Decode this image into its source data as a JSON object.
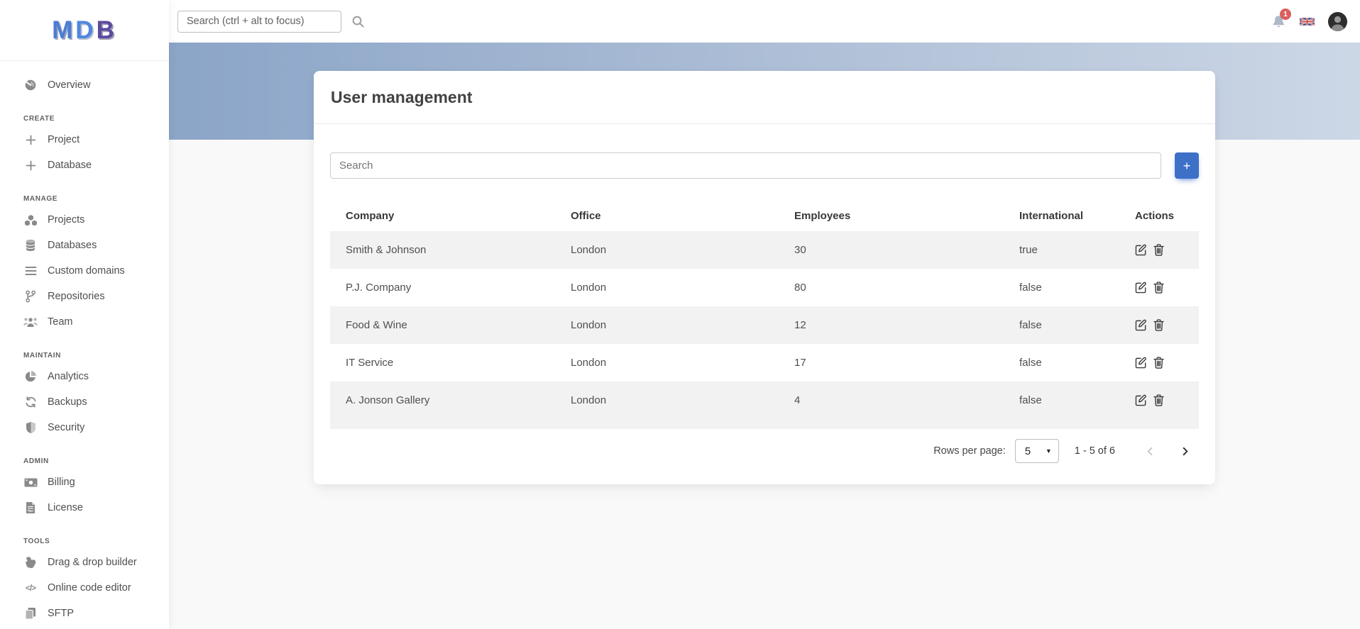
{
  "colors": {
    "accent": "#3e70c8",
    "hero_from": "#8ba5c8",
    "hero_to": "#ccd7e6",
    "stripe": "#f2f2f2",
    "badge_red": "#d9605e"
  },
  "brand": {
    "letters": [
      {
        "char": "M"
      },
      {
        "char": "D"
      },
      {
        "char": "B"
      }
    ]
  },
  "topbar": {
    "search_placeholder": "Search (ctrl + alt to focus)",
    "notification_count": "1"
  },
  "sidebar": {
    "sections": [
      {
        "label": "",
        "items": [
          {
            "label": "Overview",
            "icon": "tachometer"
          }
        ]
      },
      {
        "label": "CREATE",
        "items": [
          {
            "label": "Project",
            "icon": "plus"
          },
          {
            "label": "Database",
            "icon": "plus"
          }
        ]
      },
      {
        "label": "MANAGE",
        "items": [
          {
            "label": "Projects",
            "icon": "cubes"
          },
          {
            "label": "Databases",
            "icon": "database"
          },
          {
            "label": "Custom domains",
            "icon": "list"
          },
          {
            "label": "Repositories",
            "icon": "code-branch"
          },
          {
            "label": "Team",
            "icon": "users"
          }
        ]
      },
      {
        "label": "MAINTAIN",
        "items": [
          {
            "label": "Analytics",
            "icon": "chart-pie"
          },
          {
            "label": "Backups",
            "icon": "sync"
          },
          {
            "label": "Security",
            "icon": "shield"
          }
        ]
      },
      {
        "label": "ADMIN",
        "items": [
          {
            "label": "Billing",
            "icon": "money-bill"
          },
          {
            "label": "License",
            "icon": "file-contract"
          }
        ]
      },
      {
        "label": "TOOLS",
        "items": [
          {
            "label": "Drag & drop builder",
            "icon": "hand-pointer"
          },
          {
            "label": "Online code editor",
            "icon": "code"
          },
          {
            "label": "SFTP",
            "icon": "copy"
          }
        ]
      }
    ]
  },
  "card": {
    "title": "User management",
    "search_placeholder": "Search",
    "add_button_label": "+"
  },
  "table": {
    "columns": [
      "Company",
      "Office",
      "Employees",
      "International",
      "Actions"
    ],
    "rows": [
      {
        "company": "Smith & Johnson",
        "office": "London",
        "employees": "30",
        "international": "true"
      },
      {
        "company": "P.J. Company",
        "office": "London",
        "employees": "80",
        "international": "false"
      },
      {
        "company": "Food & Wine",
        "office": "London",
        "employees": "12",
        "international": "false"
      },
      {
        "company": "IT Service",
        "office": "London",
        "employees": "17",
        "international": "false"
      },
      {
        "company": "A. Jonson Gallery",
        "office": "London",
        "employees": "4",
        "international": "false"
      }
    ]
  },
  "pagination": {
    "rows_per_page_label": "Rows per page:",
    "rows_per_page_value": "5",
    "range_label": "1 - 5 of 6"
  }
}
